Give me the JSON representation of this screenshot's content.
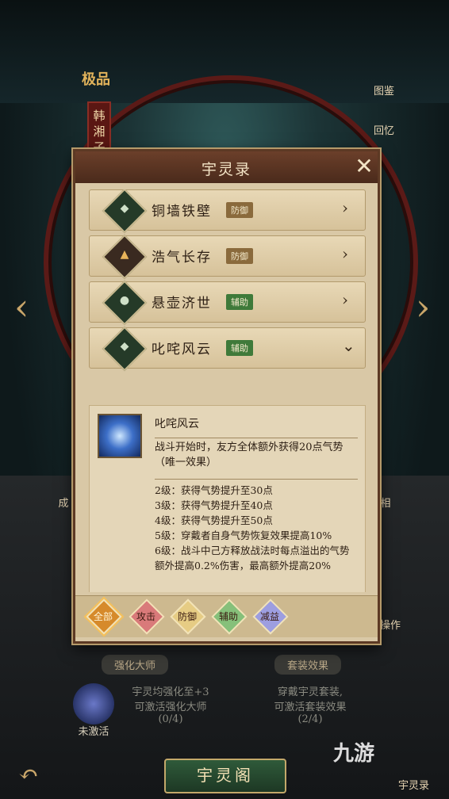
{
  "background": {
    "rank_label": "极品",
    "character_name": "韩湘子",
    "side_right": [
      "图鉴",
      "回忆"
    ],
    "side_left_mid": "成",
    "side_right_mid": "相",
    "operate_label": "操作",
    "left_panel": {
      "header": "强化大师",
      "line1": "宇灵均强化至+3",
      "line2": "可激活强化大师",
      "count": "(0/4)",
      "status": "未激活"
    },
    "right_panel": {
      "header": "套装效果",
      "line1": "穿戴宇灵套装,",
      "line2": "可激活套装效果",
      "count": "(2/4)"
    },
    "bottom_button": "宇灵阁",
    "corner_label": "宇灵录",
    "watermark": "九游"
  },
  "dialog": {
    "title": "宇灵录",
    "close_icon": "close-icon",
    "items": [
      {
        "name": "铜墙铁壁",
        "tag": "防御",
        "icon": "shield-icon",
        "state": "collapsed"
      },
      {
        "name": "浩气长存",
        "tag": "防御",
        "icon": "crest-icon",
        "state": "collapsed"
      },
      {
        "name": "悬壶济世",
        "tag": "辅助",
        "icon": "teapot-icon",
        "state": "collapsed"
      },
      {
        "name": "叱咤风云",
        "tag": "辅助",
        "icon": "wind-icon",
        "state": "expanded"
      }
    ],
    "detail": {
      "name": "叱咤风云",
      "description": "战斗开始时，友方全体额外获得20点气势（唯一效果）",
      "levels": [
        "2级：获得气势提升至30点",
        "3级：获得气势提升至40点",
        "4级：获得气势提升至50点",
        "5级：穿戴者自身气势恢复效果提高10%",
        "6级：战斗中己方释放战法时每点溢出的气势额外提高0.2%伤害，最高额外提高20%"
      ]
    },
    "filters": [
      {
        "label": "全部",
        "selected": true
      },
      {
        "label": "攻击",
        "selected": false
      },
      {
        "label": "防御",
        "selected": false
      },
      {
        "label": "辅助",
        "selected": false
      },
      {
        "label": "减益",
        "selected": false
      }
    ]
  }
}
